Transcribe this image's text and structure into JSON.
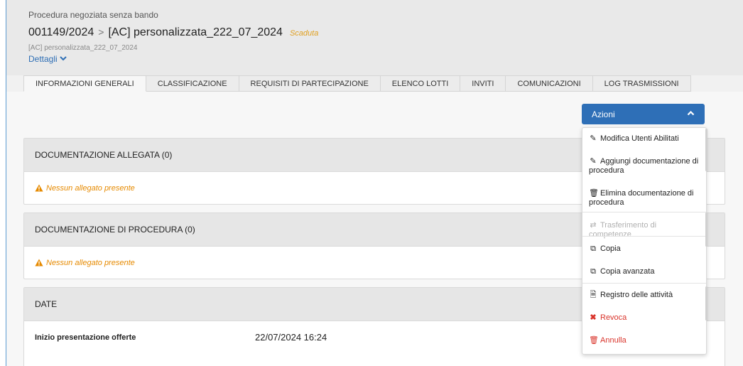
{
  "header": {
    "procedure_type": "Procedura negoziata senza bando",
    "code": "001149/2024",
    "separator": ">",
    "name": "[AC] personalizzata_222_07_2024",
    "status": "Scaduta",
    "subtitle": "[AC] personalizzata_222_07_2024",
    "details_label": "Dettagli"
  },
  "tabs": [
    {
      "label": "INFORMAZIONI GENERALI"
    },
    {
      "label": "CLASSIFICAZIONE"
    },
    {
      "label": "REQUISITI DI PARTECIPAZIONE"
    },
    {
      "label": "ELENCO LOTTI"
    },
    {
      "label": "INVITI"
    },
    {
      "label": "COMUNICAZIONI"
    },
    {
      "label": "LOG TRASMISSIONI"
    }
  ],
  "actions": {
    "button_label": "Azioni",
    "items": [
      {
        "label": "Modifica Utenti Abilitati",
        "icon": "edit-icon"
      },
      {
        "label": "Aggiungi documentazione di procedura",
        "icon": "edit-icon"
      },
      {
        "label": "Elimina documentazione di procedura",
        "icon": "trash-icon"
      },
      {
        "label": "Trasferimento di competenze",
        "icon": "shuffle-icon"
      },
      {
        "label": "Copia",
        "icon": "copy-icon"
      },
      {
        "label": "Copia avanzata",
        "icon": "copy-icon"
      },
      {
        "label": "Registro delle attività",
        "icon": "file-text-icon"
      },
      {
        "label": "Revoca",
        "icon": "times-icon"
      },
      {
        "label": "Annulla",
        "icon": "trash-icon"
      }
    ]
  },
  "panels": {
    "doc_allegata": {
      "title": "DOCUMENTAZIONE ALLEGATA (0)",
      "empty_message": "Nessun allegato presente"
    },
    "doc_procedura": {
      "title": "DOCUMENTAZIONE DI PROCEDURA (0)",
      "empty_message": "Nessun allegato presente"
    },
    "date": {
      "title": "DATE",
      "rows": [
        {
          "label": "Inizio presentazione offerte",
          "value": "22/07/2024 16:24"
        }
      ]
    }
  },
  "colors": {
    "accent": "#2e6fb7",
    "warning": "#e68a00",
    "danger": "#d9342b",
    "status": "#e0a020"
  }
}
